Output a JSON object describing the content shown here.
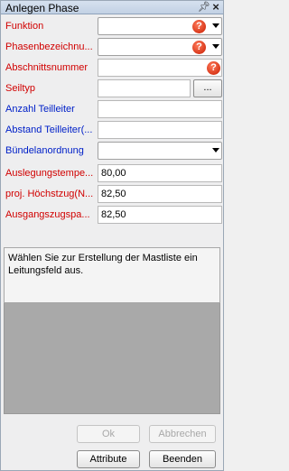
{
  "panel": {
    "title": "Anlegen Phase",
    "pin_icon": "pin-icon",
    "close_icon": "close-icon"
  },
  "fields": {
    "funktion": {
      "label": "Funktion"
    },
    "phasenbezeichnung": {
      "label": "Phasenbezeichnu..."
    },
    "abschnittsnummer": {
      "label": "Abschnittsnummer",
      "value": ""
    },
    "seiltyp": {
      "label": "Seiltyp",
      "value": "",
      "browse_label": "..."
    },
    "anzahl_teilleiter": {
      "label": "Anzahl Teilleiter",
      "value": ""
    },
    "abstand_teilleiter": {
      "label": "Abstand Teilleiter(...",
      "value": ""
    },
    "buendelanordnung": {
      "label": "Bündelanordnung"
    },
    "auslegungstemperatur": {
      "label": "Auslegungstempe...",
      "value": "80,00"
    },
    "hoechstzug": {
      "label": "proj. Höchstzug(N...",
      "value": "82,50"
    },
    "ausgangszugspannung": {
      "label": "Ausgangszugspa...",
      "value": "82,50"
    }
  },
  "help_glyph": "?",
  "message": "Wählen Sie zur Erstellung der Mastliste ein Leitungsfeld aus.",
  "buttons": {
    "ok": {
      "label": "Ok",
      "enabled": false
    },
    "abbrechen": {
      "label": "Abbrechen",
      "enabled": false
    },
    "attribute": {
      "label": "Attribute",
      "enabled": true
    },
    "beenden": {
      "label": "Beenden",
      "enabled": true
    }
  },
  "colors": {
    "required_label": "#d10000",
    "optional_label": "#0020c8",
    "help_icon": "#c81c00"
  }
}
